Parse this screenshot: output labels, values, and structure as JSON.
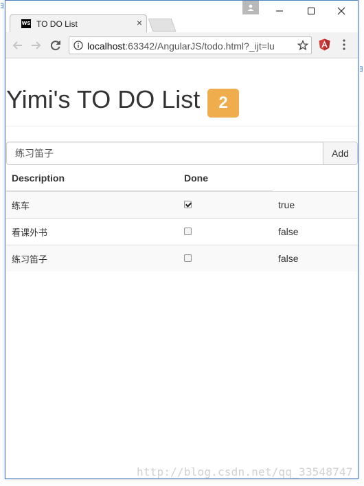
{
  "browser": {
    "tab_title": "TO DO List",
    "favicon_text": "WS",
    "url_host": "localhost",
    "url_rest": ":63342/AngularJS/todo.html?_ijt=lu"
  },
  "app": {
    "title": "Yimi's TO DO List",
    "incomplete_count": "2",
    "input_value": "练习笛子",
    "add_label": "Add",
    "columns": [
      "Description",
      "Done"
    ],
    "items": [
      {
        "description": "练车",
        "done": true,
        "done_text": "true"
      },
      {
        "description": "看课外书",
        "done": false,
        "done_text": "false"
      },
      {
        "description": "练习笛子",
        "done": false,
        "done_text": "false"
      }
    ],
    "badge_color": "#f0ad4e"
  },
  "watermark": "http://blog.csdn.net/qq_33548747"
}
